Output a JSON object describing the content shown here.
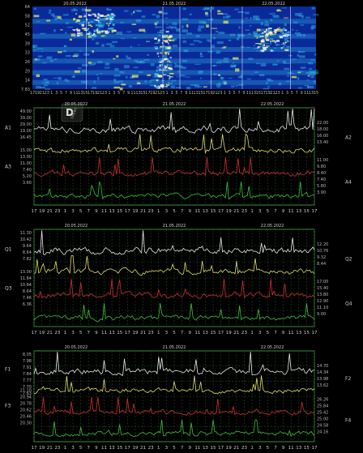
{
  "chart_data": [
    {
      "type": "heatmap",
      "title": "",
      "dates": [
        "20.05.2022",
        "21.05.2022",
        "22.05.2022"
      ],
      "y_ticks": [
        "7.83",
        "14",
        "20",
        "26",
        "33",
        "39",
        "45",
        "52",
        "58",
        "64"
      ],
      "colors": {
        "low": "#0a2a9a",
        "mid": "#2fb0e0",
        "high": "#f0f060",
        "peak": "#ffffff"
      }
    },
    {
      "type": "line",
      "dates": [
        "20.05.2022",
        "21.05.2022",
        "22.05.2022"
      ],
      "hours": [
        "17",
        "19",
        "21",
        "23",
        "1",
        "3",
        "5",
        "7",
        "9",
        "11",
        "13",
        "15",
        "17",
        "19",
        "21",
        "23",
        "1",
        "3",
        "5",
        "7",
        "9",
        "11",
        "13",
        "15",
        "17",
        "19",
        "21",
        "23",
        "1",
        "3",
        "5",
        "7",
        "9",
        "11",
        "13",
        "15",
        "17"
      ],
      "left_axis": {
        "a1": "A1",
        "a3": "A3",
        "ticks_a1": [
          "49.00",
          "39.00",
          "29.00",
          "19.00",
          "16.45"
        ],
        "ticks_a3": [
          "15.00",
          "13.00",
          "11.00",
          "7.40",
          "5.20",
          "3.60"
        ]
      },
      "right_axis": {
        "a2": "A2",
        "a4": "A4",
        "ticks_a2": [
          "22.00",
          "18.00",
          "16.00",
          "13.40"
        ],
        "ticks_a4": [
          "11.00",
          "9.80",
          "8.40",
          "7.40",
          "5.80",
          "3.90"
        ]
      },
      "series": [
        {
          "name": "A1",
          "color": "#e8e8e8"
        },
        {
          "name": "A2",
          "color": "#e0e060"
        },
        {
          "name": "A3",
          "color": "#d03030"
        },
        {
          "name": "A4",
          "color": "#3ec23e"
        }
      ]
    },
    {
      "type": "line",
      "dates": [
        "20.05.2022",
        "21.05.2022",
        "22.05.2022"
      ],
      "hours": [
        "17",
        "19",
        "21",
        "23",
        "1",
        "3",
        "5",
        "7",
        "9",
        "11",
        "13",
        "15",
        "17",
        "19",
        "21",
        "23",
        "1",
        "3",
        "5",
        "7",
        "9",
        "11",
        "13",
        "15",
        "17",
        "19",
        "21",
        "23",
        "1",
        "3",
        "5",
        "7",
        "9",
        "11",
        "13",
        "15",
        "17"
      ],
      "left_axis": {
        "a1": "Q1",
        "a3": "Q3",
        "ticks_a1": [
          "11.30",
          "10.42",
          "9.64",
          "8.64",
          "7.82"
        ],
        "ticks_a3": [
          "13.00",
          "11.84",
          "10.84",
          "8.64",
          "7.46",
          "6.36"
        ]
      },
      "right_axis": {
        "a2": "Q2",
        "a4": "Q4",
        "ticks_a2": [
          "12.20",
          "10.76",
          "9.32",
          "8.44"
        ],
        "ticks_a4": [
          "17.00",
          "15.40",
          "13.80",
          "12.90",
          "11.10",
          "9.00"
        ]
      },
      "series": [
        {
          "name": "Q1",
          "color": "#e8e8e8"
        },
        {
          "name": "Q2",
          "color": "#e0e060"
        },
        {
          "name": "Q3",
          "color": "#d03030"
        },
        {
          "name": "Q4",
          "color": "#3ec23e"
        }
      ]
    },
    {
      "type": "line",
      "dates": [
        "20.05.2022",
        "21.05.2022",
        "22.05.2022"
      ],
      "hours": [
        "17",
        "19",
        "21",
        "23",
        "1",
        "3",
        "5",
        "7",
        "9",
        "11",
        "13",
        "15",
        "17",
        "19",
        "21",
        "23",
        "1",
        "3",
        "5",
        "7",
        "9",
        "11",
        "13",
        "15",
        "17",
        "19",
        "21",
        "23",
        "1",
        "3",
        "5",
        "7",
        "9",
        "11",
        "13",
        "15",
        "17"
      ],
      "left_axis": {
        "a1": "F1",
        "a3": "F3",
        "ticks_a1": [
          "8.05",
          "7.98",
          "7.91",
          "7.84",
          "7.77",
          "7.70",
          "7.63"
        ],
        "ticks_a3": [
          "21.10",
          "20.94",
          "20.78",
          "20.62",
          "20.46",
          "20.30"
        ]
      },
      "right_axis": {
        "a2": "F2",
        "a4": "F4",
        "ticks_a2": [
          "14.70",
          "14.34",
          "13.98",
          "13.62"
        ],
        "ticks_a4": [
          "26.26",
          "25.84",
          "25.42",
          "25.00",
          "24.58",
          "24.16"
        ]
      },
      "series": [
        {
          "name": "F1",
          "color": "#e8e8e8"
        },
        {
          "name": "F2",
          "color": "#e0e060"
        },
        {
          "name": "F3",
          "color": "#d03030"
        },
        {
          "name": "F4",
          "color": "#3ec23e"
        }
      ]
    }
  ],
  "watermark": "DNEWS"
}
